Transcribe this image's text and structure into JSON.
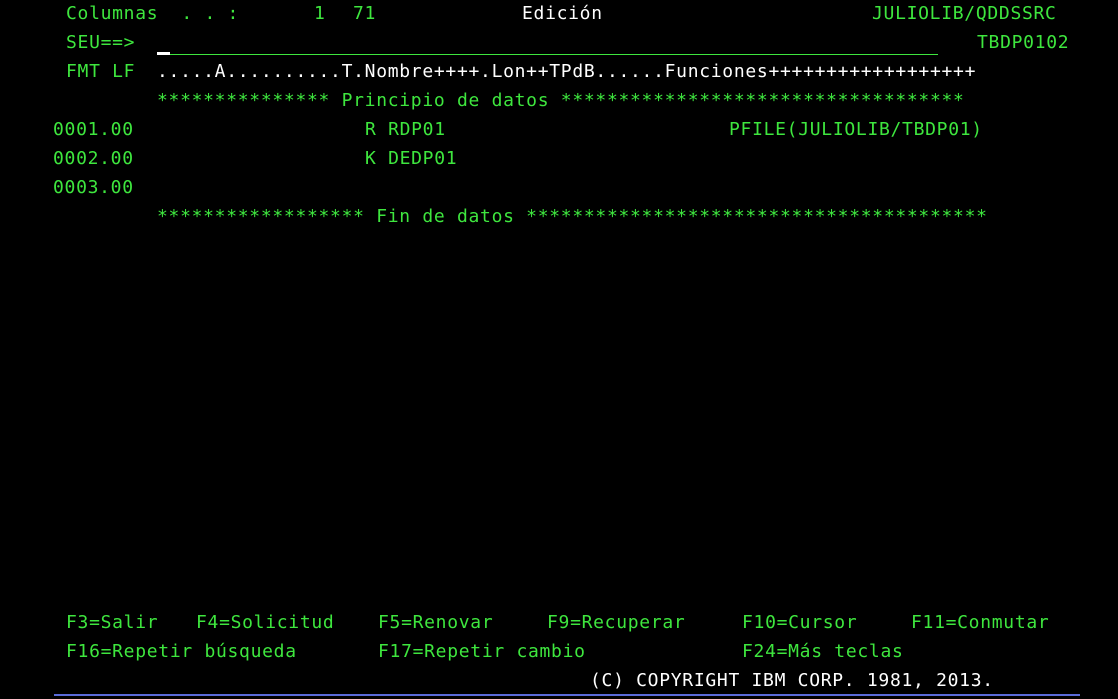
{
  "header": {
    "columns_label": "Columnas  . . :",
    "col_from": "1",
    "col_to": "71",
    "mode": "Edición",
    "member_path": "JULIOLIB/QDDSSRC",
    "member_name": "TBDP0102",
    "seu_prompt": "SEU==>",
    "seu_value": "",
    "format_label": "FMT LF",
    "format_ruler": ".....A..........T.Nombre++++.Lon++TPdB......Funciones++++++++++++++++++"
  },
  "data": {
    "start_marker": "*************** Principio de datos ***********************************",
    "end_marker": "****************** Fin de datos ****************************************",
    "lines": [
      {
        "seq": "0001.00",
        "code": "R RDP01",
        "functions": "PFILE(JULIOLIB/TBDP01)"
      },
      {
        "seq": "0002.00",
        "code": "K DEDP01",
        "functions": ""
      },
      {
        "seq": "0003.00",
        "code": "",
        "functions": ""
      }
    ]
  },
  "function_keys": {
    "f3": "F3=Salir",
    "f4": "F4=Solicitud",
    "f5": "F5=Renovar",
    "f9": "F9=Recuperar",
    "f10": "F10=Cursor",
    "f11": "F11=Conmutar",
    "f16": "F16=Repetir búsqueda",
    "f17": "F17=Repetir cambio",
    "f24": "F24=Más teclas"
  },
  "copyright": "(C) COPYRIGHT IBM CORP. 1981, 2013.",
  "colors": {
    "text_green": "#3ee63e",
    "text_white": "#ffffff",
    "background": "#000000",
    "bottom_rule": "#5a6bd8"
  }
}
